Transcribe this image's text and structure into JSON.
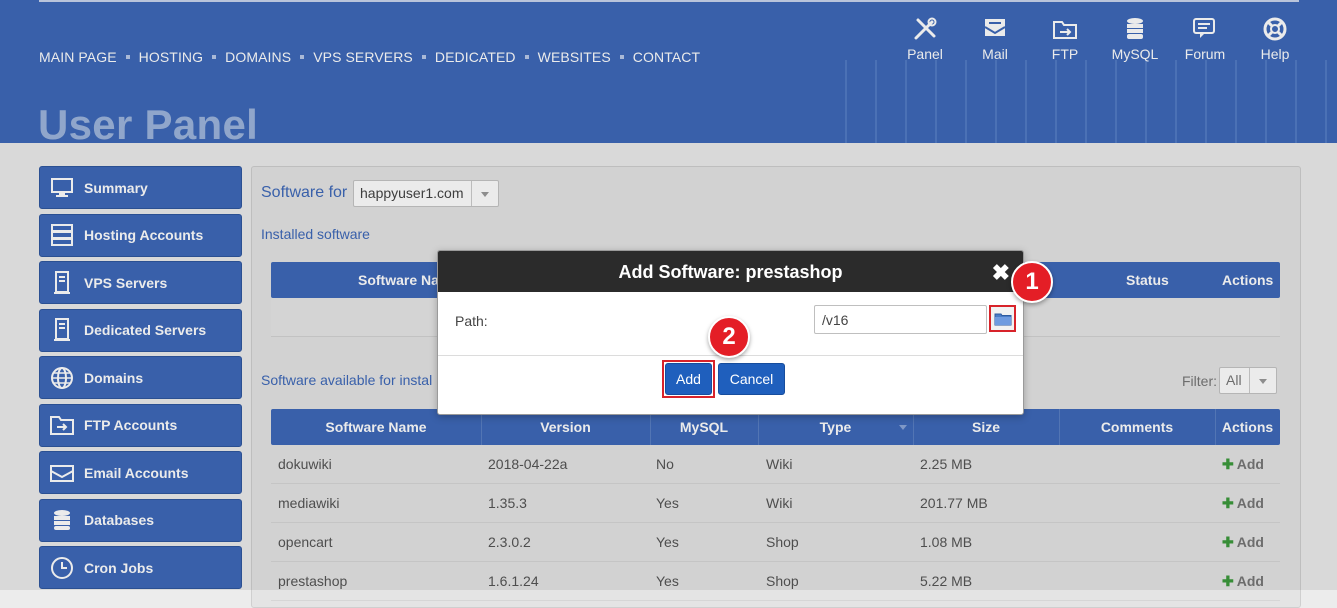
{
  "nav": [
    "MAIN PAGE",
    "HOSTING",
    "DOMAINS",
    "VPS SERVERS",
    "DEDICATED",
    "WEBSITES",
    "CONTACT"
  ],
  "tools": [
    {
      "label": "Panel",
      "icon": "wrench-screwdriver-icon"
    },
    {
      "label": "Mail",
      "icon": "mail-icon"
    },
    {
      "label": "FTP",
      "icon": "folder-icon"
    },
    {
      "label": "MySQL",
      "icon": "database-icon"
    },
    {
      "label": "Forum",
      "icon": "chat-icon"
    },
    {
      "label": "Help",
      "icon": "lifebuoy-icon"
    }
  ],
  "page_title": "User Panel",
  "sidebar": [
    {
      "label": "Summary",
      "icon": "monitor-icon"
    },
    {
      "label": "Hosting Accounts",
      "icon": "server-icon"
    },
    {
      "label": "VPS Servers",
      "icon": "tower-icon"
    },
    {
      "label": "Dedicated Servers",
      "icon": "tower-icon"
    },
    {
      "label": "Domains",
      "icon": "globe-icon"
    },
    {
      "label": "FTP Accounts",
      "icon": "folder-icon"
    },
    {
      "label": "Email Accounts",
      "icon": "envelope-icon"
    },
    {
      "label": "Databases",
      "icon": "database-icon"
    },
    {
      "label": "Cron Jobs",
      "icon": "clock-icon"
    }
  ],
  "content": {
    "software_for_label": "Software for",
    "domain": "happyuser1.com",
    "installed_label": "Installed software",
    "installed_headers": {
      "name": "Software Na",
      "status": "Status",
      "actions": "Actions"
    },
    "available_label": "Software available for instal",
    "filter_label": "Filter:",
    "filter_value": "All",
    "available_headers": [
      "Software Name",
      "Version",
      "MySQL",
      "Type",
      "Size",
      "Comments",
      "Actions"
    ],
    "rows": [
      {
        "name": "dokuwiki",
        "version": "2018-04-22a",
        "mysql": "No",
        "type": "Wiki",
        "size": "2.25 MB",
        "action": "Add"
      },
      {
        "name": "mediawiki",
        "version": "1.35.3",
        "mysql": "Yes",
        "type": "Wiki",
        "size": "201.77 MB",
        "action": "Add"
      },
      {
        "name": "opencart",
        "version": "2.3.0.2",
        "mysql": "Yes",
        "type": "Shop",
        "size": "1.08 MB",
        "action": "Add"
      },
      {
        "name": "prestashop",
        "version": "1.6.1.24",
        "mysql": "Yes",
        "type": "Shop",
        "size": "5.22 MB",
        "action": "Add"
      }
    ]
  },
  "modal": {
    "title": "Add Software: prestashop",
    "path_label": "Path:",
    "path_value": "/v16",
    "add_button": "Add",
    "cancel_button": "Cancel",
    "close_glyph": "✖"
  },
  "callouts": {
    "one": "1",
    "two": "2"
  },
  "colors": {
    "brand": "#3e69b9",
    "accent": "#e41e26",
    "button": "#1f5fbd"
  }
}
